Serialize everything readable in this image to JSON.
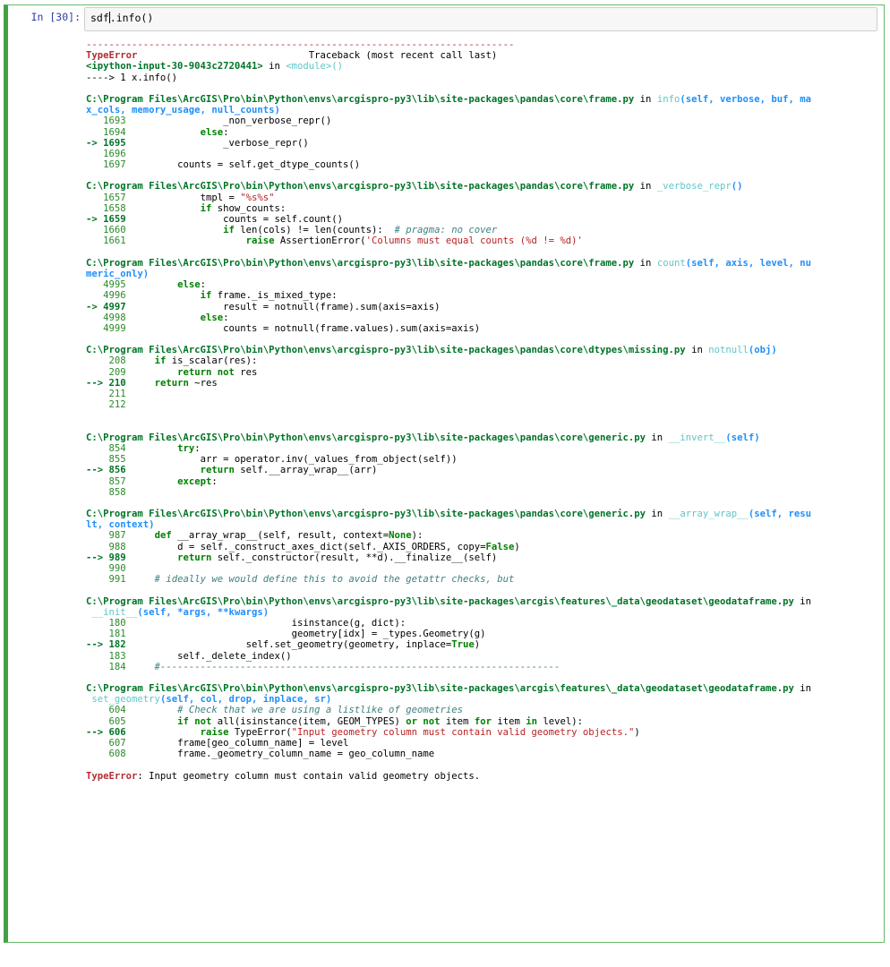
{
  "cell": {
    "prompt": "In [30]:",
    "input_before_caret": "sdf",
    "input_after_caret": ".info()"
  },
  "traceback": {
    "dash_line": "---------------------------------------------------------------------------",
    "error_name": "TypeError",
    "header_right": "Traceback (most recent call last)",
    "ipython_input": "<ipython-input-30-9043c2720441>",
    "in_word": " in ",
    "module": "<module>()",
    "first_arrow": "----> 1 x.info()",
    "frames": [
      {
        "path": "C:\\Program Files\\ArcGIS\\Pro\\bin\\Python\\envs\\arcgispro-py3\\lib\\site-packages\\pandas\\core\\frame.py",
        "func": "info",
        "sig1": "(self, verbose, buf, ma",
        "sig2": "x_cols, memory_usage, null_counts)",
        "lines": [
          {
            "no": "   1693",
            "code": "                _non_verbose_repr()"
          },
          {
            "no": "   1694",
            "code": "            else:"
          },
          {
            "no": "-> 1695",
            "code": "                _verbose_repr()",
            "cur": true
          },
          {
            "no": "   1696",
            "code": ""
          },
          {
            "no": "   1697",
            "code": "        counts = self.get_dtype_counts()"
          }
        ]
      },
      {
        "path": "C:\\Program Files\\ArcGIS\\Pro\\bin\\Python\\envs\\arcgispro-py3\\lib\\site-packages\\pandas\\core\\frame.py",
        "func": "_verbose_repr",
        "sig1": "()",
        "sig2": "",
        "lines": [
          {
            "no": "   1657",
            "code": "            tmpl = \"%s%s\""
          },
          {
            "no": "   1658",
            "code": "            if show_counts:"
          },
          {
            "no": "-> 1659",
            "code": "                counts = self.count()",
            "cur": true
          },
          {
            "no": "   1660",
            "code": "                if len(cols) != len(counts):  # pragma: no cover"
          },
          {
            "no": "   1661",
            "code": "                    raise AssertionError('Columns must equal counts (%d != %d)'"
          }
        ]
      },
      {
        "path": "C:\\Program Files\\ArcGIS\\Pro\\bin\\Python\\envs\\arcgispro-py3\\lib\\site-packages\\pandas\\core\\frame.py",
        "func": "count",
        "sig1": "(self, axis, level, nu",
        "sig2": "meric_only)",
        "lines": [
          {
            "no": "   4995",
            "code": "        else:"
          },
          {
            "no": "   4996",
            "code": "            if frame._is_mixed_type:"
          },
          {
            "no": "-> 4997",
            "code": "                result = notnull(frame).sum(axis=axis)",
            "cur": true
          },
          {
            "no": "   4998",
            "code": "            else:"
          },
          {
            "no": "   4999",
            "code": "                counts = notnull(frame.values).sum(axis=axis)"
          }
        ]
      },
      {
        "path": "C:\\Program Files\\ArcGIS\\Pro\\bin\\Python\\envs\\arcgispro-py3\\lib\\site-packages\\pandas\\core\\dtypes\\missing.py",
        "func": "notnull",
        "sig1": "(obj)",
        "sig2": "",
        "lines": [
          {
            "no": "    208",
            "code": "    if is_scalar(res):"
          },
          {
            "no": "    209",
            "code": "        return not res"
          },
          {
            "no": "--> 210",
            "code": "    return ~res",
            "cur": true
          },
          {
            "no": "    211",
            "code": ""
          },
          {
            "no": "    212",
            "code": ""
          }
        ],
        "extra_gap": true
      },
      {
        "path": "C:\\Program Files\\ArcGIS\\Pro\\bin\\Python\\envs\\arcgispro-py3\\lib\\site-packages\\pandas\\core\\generic.py",
        "func": "__invert__",
        "sig1": "(self)",
        "sig2": "",
        "lines": [
          {
            "no": "    854",
            "code": "        try:"
          },
          {
            "no": "    855",
            "code": "            arr = operator.inv(_values_from_object(self))"
          },
          {
            "no": "--> 856",
            "code": "            return self.__array_wrap__(arr)",
            "cur": true
          },
          {
            "no": "    857",
            "code": "        except:"
          },
          {
            "no": "    858",
            "code": ""
          }
        ]
      },
      {
        "path": "C:\\Program Files\\ArcGIS\\Pro\\bin\\Python\\envs\\arcgispro-py3\\lib\\site-packages\\pandas\\core\\generic.py",
        "func": "__array_wrap__",
        "sig1": "(self, resu",
        "sig2": "lt, context)",
        "lines": [
          {
            "no": "    987",
            "code": "    def __array_wrap__(self, result, context=None):"
          },
          {
            "no": "    988",
            "code": "        d = self._construct_axes_dict(self._AXIS_ORDERS, copy=False)"
          },
          {
            "no": "--> 989",
            "code": "        return self._constructor(result, **d).__finalize__(self)",
            "cur": true
          },
          {
            "no": "    990",
            "code": ""
          },
          {
            "no": "    991",
            "code": "    # ideally we would define this to avoid the getattr checks, but"
          }
        ]
      },
      {
        "path": "C:\\Program Files\\ArcGIS\\Pro\\bin\\Python\\envs\\arcgispro-py3\\lib\\site-packages\\arcgis\\features\\_data\\geodataset\\geodataframe.py",
        "func": "__init__",
        "sig1": "",
        "sig2": "(self, *args, **kwargs)",
        "lines": [
          {
            "no": "    180",
            "code": "                            isinstance(g, dict):"
          },
          {
            "no": "    181",
            "code": "                            geometry[idx] = _types.Geometry(g)"
          },
          {
            "no": "--> 182",
            "code": "                    self.set_geometry(geometry, inplace=True)",
            "cur": true
          },
          {
            "no": "    183",
            "code": "        self._delete_index()"
          },
          {
            "no": "    184",
            "code": "    #----------------------------------------------------------------------"
          }
        ]
      },
      {
        "path": "C:\\Program Files\\ArcGIS\\Pro\\bin\\Python\\envs\\arcgispro-py3\\lib\\site-packages\\arcgis\\features\\_data\\geodataset\\geodataframe.py",
        "func": "set_geometry",
        "sig1": "",
        "sig2": "(self, col, drop, inplace, sr)",
        "lines": [
          {
            "no": "    604",
            "code": "        # Check that we are using a listlike of geometries"
          },
          {
            "no": "    605",
            "code": "        if not all(isinstance(item, GEOM_TYPES) or not item for item in level):"
          },
          {
            "no": "--> 606",
            "code": "            raise TypeError(\"Input geometry column must contain valid geometry objects.\")",
            "cur": true
          },
          {
            "no": "    607",
            "code": "        frame[geo_column_name] = level"
          },
          {
            "no": "    608",
            "code": "        frame._geometry_column_name = geo_column_name"
          }
        ]
      }
    ],
    "final_error": {
      "name": "TypeError",
      "message": ": Input geometry column must contain valid geometry objects."
    }
  }
}
